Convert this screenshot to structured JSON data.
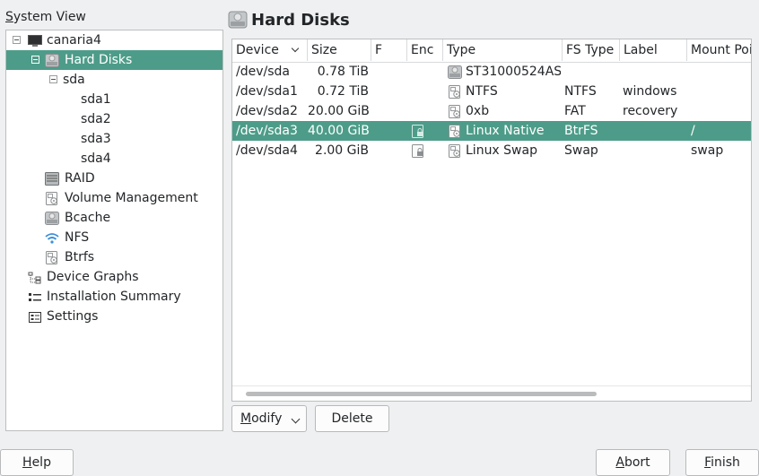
{
  "system_view": {
    "title_first": "S",
    "title_rest": "ystem View",
    "tree": [
      {
        "label": "canaria4",
        "icon": "computer-icon",
        "level": 0
      },
      {
        "label": "Hard Disks",
        "icon": "hard-disk-icon",
        "level": 1,
        "selected": true
      },
      {
        "label": "sda",
        "icon": "",
        "level": 2
      },
      {
        "label": "sda1",
        "icon": "",
        "level": 3
      },
      {
        "label": "sda2",
        "icon": "",
        "level": 3
      },
      {
        "label": "sda3",
        "icon": "",
        "level": 3
      },
      {
        "label": "sda4",
        "icon": "",
        "level": 3
      },
      {
        "label": "RAID",
        "icon": "raid-icon",
        "level": 1
      },
      {
        "label": "Volume Management",
        "icon": "volume-icon",
        "level": 1
      },
      {
        "label": "Bcache",
        "icon": "bcache-icon",
        "level": 1
      },
      {
        "label": "NFS",
        "icon": "nfs-wifi-icon",
        "level": 1
      },
      {
        "label": "Btrfs",
        "icon": "btrfs-icon",
        "level": 1
      },
      {
        "label": "Device Graphs",
        "icon": "device-graphs-icon",
        "level": 0
      },
      {
        "label": "Installation Summary",
        "icon": "summary-icon",
        "level": 0
      },
      {
        "label": "Settings",
        "icon": "settings-icon",
        "level": 0
      }
    ]
  },
  "main": {
    "title": "Hard Disks",
    "columns": [
      "Device",
      "Size",
      "F",
      "Enc",
      "Type",
      "FS Type",
      "Label",
      "Mount Poi"
    ],
    "rows": [
      {
        "device": "/dev/sda",
        "size": "0.78 TiB",
        "enc": false,
        "type": "ST31000524AS",
        "type_icon": "disk-icon",
        "fs": "",
        "label": "",
        "mount": ""
      },
      {
        "device": "/dev/sda1",
        "size": "0.72 TiB",
        "enc": false,
        "type": "NTFS",
        "type_icon": "partition-icon",
        "fs": "NTFS",
        "label": "windows",
        "mount": ""
      },
      {
        "device": "/dev/sda2",
        "size": "20.00 GiB",
        "enc": false,
        "type": "0xb",
        "type_icon": "partition-icon",
        "fs": "FAT",
        "label": "recovery",
        "mount": ""
      },
      {
        "device": "/dev/sda3",
        "size": "40.00 GiB",
        "enc": true,
        "type": "Linux Native",
        "type_icon": "partition-icon",
        "fs": "BtrFS",
        "label": "",
        "mount": "/",
        "selected": true
      },
      {
        "device": "/dev/sda4",
        "size": "2.00 GiB",
        "enc": true,
        "type": "Linux Swap",
        "type_icon": "partition-icon",
        "fs": "Swap",
        "label": "",
        "mount": "swap"
      }
    ],
    "sort_indicator": "chevron-down-icon"
  },
  "buttons": {
    "modify_first": "M",
    "modify_rest": "odify",
    "delete": "Delete",
    "help_first": "H",
    "help_rest": "elp",
    "abort_first": "A",
    "abort_rest": "bort",
    "finish_first": "F",
    "finish_rest": "inish"
  },
  "colors": {
    "selection": "#4d9c89",
    "window_bg": "#eff0f1"
  }
}
